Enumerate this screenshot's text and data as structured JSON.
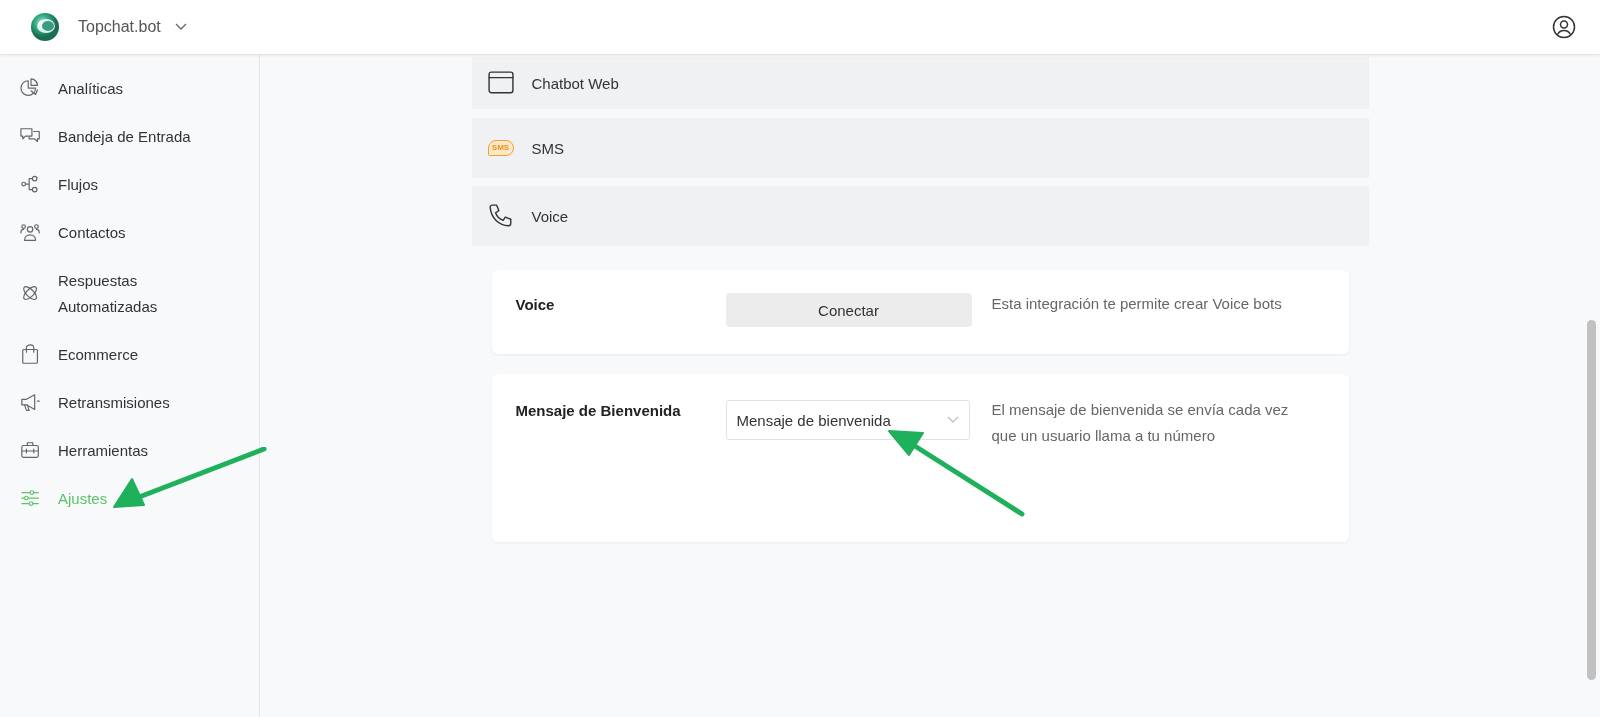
{
  "header": {
    "workspace": "Topchat.bot"
  },
  "sidebar": {
    "items": [
      {
        "label": "Analíticas",
        "kind": "pie",
        "selected": false,
        "annotated": false
      },
      {
        "label": "Bandeja de Entrada",
        "kind": "chat",
        "selected": false,
        "annotated": false
      },
      {
        "label": "Flujos",
        "kind": "flow",
        "selected": false,
        "annotated": false
      },
      {
        "label": "Contactos",
        "kind": "people",
        "selected": false,
        "annotated": false
      },
      {
        "label": "Respuestas Automatizadas",
        "kind": "atom",
        "selected": false,
        "annotated": false
      },
      {
        "label": "Ecommerce",
        "kind": "bag",
        "selected": false,
        "annotated": false
      },
      {
        "label": "Retransmisiones",
        "kind": "megaphone",
        "selected": false,
        "annotated": false
      },
      {
        "label": "Herramientas",
        "kind": "toolbox",
        "selected": false,
        "annotated": false
      },
      {
        "label": "Ajustes",
        "kind": "sliders",
        "selected": true,
        "annotated": true
      }
    ]
  },
  "channels": [
    {
      "label": "Chatbot Web",
      "kind": "window"
    },
    {
      "label": "SMS",
      "kind": "sms",
      "icon_text": "SMS"
    },
    {
      "label": "Voice",
      "kind": "phone"
    }
  ],
  "cards": [
    {
      "kind": "button",
      "title": "Voice",
      "control": "Conectar",
      "description": "Esta integración te permite crear Voice bots",
      "annotated": false
    },
    {
      "kind": "select",
      "title": "Mensaje de Bienvenida",
      "control": "Mensaje de bienvenida",
      "description": "El mensaje de bienvenida se envía cada vez que un usuario llama a tu número",
      "annotated": true
    }
  ]
}
